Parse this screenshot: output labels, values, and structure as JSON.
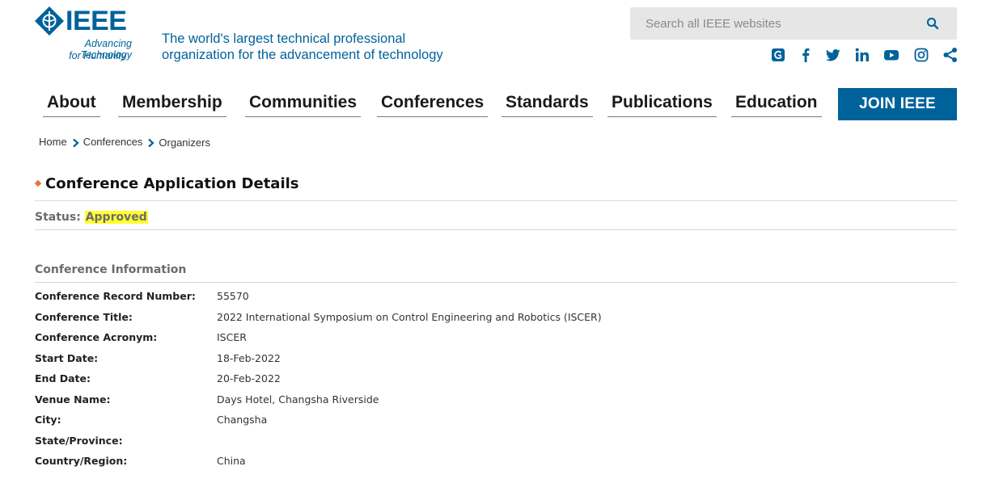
{
  "logo": {
    "wordmark": "IEEE",
    "tagline_line1": "Advancing Technology",
    "tagline_line2": "for Humanity",
    "color": "#00629b"
  },
  "header": {
    "tagline_line1": "The world's largest technical professional",
    "tagline_line2": "organization for the advancement of technology"
  },
  "search": {
    "placeholder": "Search all IEEE websites",
    "value": "",
    "icon": "search-icon"
  },
  "social": [
    "ieee-collabratec-icon",
    "facebook-icon",
    "twitter-icon",
    "linkedin-icon",
    "youtube-icon",
    "instagram-icon",
    "share-icon"
  ],
  "nav": {
    "items": [
      {
        "label": "About"
      },
      {
        "label": "Membership"
      },
      {
        "label": "Communities"
      },
      {
        "label": "Conferences"
      },
      {
        "label": "Standards"
      },
      {
        "label": "Publications"
      },
      {
        "label": "Education"
      }
    ],
    "join_label": "JOIN IEEE"
  },
  "breadcrumb": [
    "Home",
    "Conferences",
    "Organizers"
  ],
  "page": {
    "title": "Conference Application Details",
    "status_label": "Status:",
    "status_value": "Approved",
    "section_title": "Conference Information"
  },
  "details": [
    {
      "label": "Conference Record Number:",
      "value": "55570"
    },
    {
      "label": "Conference Title:",
      "value": "2022 International Symposium on Control Engineering and Robotics (ISCER)"
    },
    {
      "label": "Conference Acronym:",
      "value": "ISCER"
    },
    {
      "label": "Start Date:",
      "value": "18-Feb-2022"
    },
    {
      "label": "End Date:",
      "value": "20-Feb-2022"
    },
    {
      "label": "Venue Name:",
      "value": "Days Hotel, Changsha Riverside"
    },
    {
      "label": "City:",
      "value": "Changsha"
    },
    {
      "label": "State/Province:",
      "value": ""
    },
    {
      "label": "Country/Region:",
      "value": "China"
    }
  ],
  "colors": {
    "brand_blue": "#00629b",
    "accent_orange": "#e07a2f",
    "highlight_yellow": "#ffff33"
  }
}
